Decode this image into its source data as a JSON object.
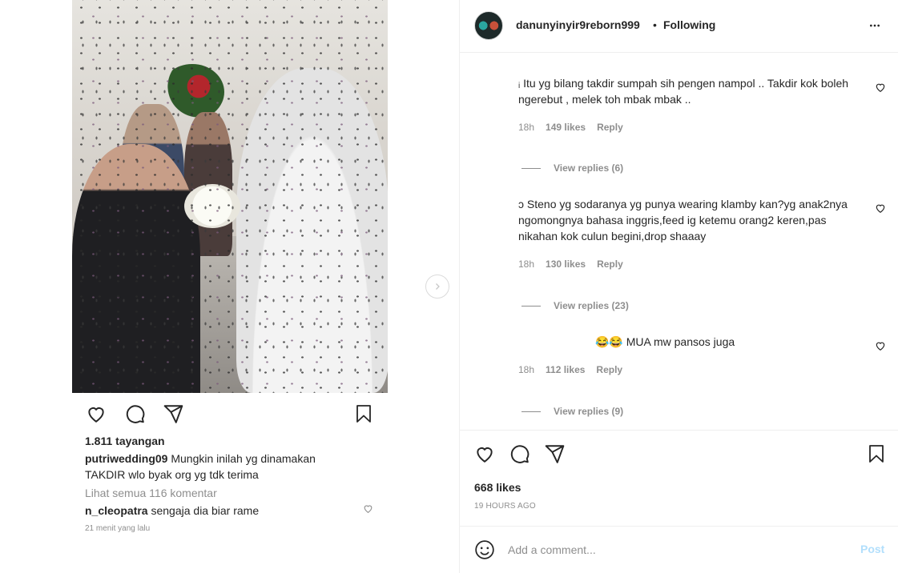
{
  "post": {
    "views": "1.811 tayangan",
    "caption_user": "putriwedding09",
    "caption_text": " Mungkin inilah yg dinamakan TAKDIR wlo byak org yg tdk terima",
    "see_all": "Lihat semua 116 komentar",
    "inner_comment_user": "n_cleopatra",
    "inner_comment_text": " sengaja dia biar rame",
    "inner_time": "21 menit yang lalu"
  },
  "header": {
    "username": "danunyinyir9reborn999",
    "separator": "•",
    "follow_status": "Following"
  },
  "comments": [
    {
      "text": "ᵢ Itu yg bilang takdir sumpah sih pengen nampol .. Takdir kok boleh ngerebut , melek toh mbak mbak ..",
      "time": "18h",
      "likes": "149 likes",
      "reply": "Reply",
      "view_replies": "View replies (6)"
    },
    {
      "text": "ↄ Steno yg sodaranya yg punya wearing klamby kan?yg anak2nya ngomongnya bahasa inggris,feed ig ketemu orang2 keren,pas nikahan kok culun begini,drop shaaay",
      "time": "18h",
      "likes": "130 likes",
      "reply": "Reply",
      "view_replies": "View replies (23)"
    },
    {
      "text": "😂😂 MUA mw pansos juga",
      "time": "18h",
      "likes": "112 likes",
      "reply": "Reply",
      "view_replies": "View replies (9)"
    }
  ],
  "footer": {
    "likes": "668 likes",
    "time_ago": "19 HOURS AGO",
    "comment_placeholder": "Add a comment...",
    "post_label": "Post"
  },
  "colors": {
    "text": "#262626",
    "muted": "#8e8e8e",
    "border": "#efefef",
    "post_disabled": "#b2dffc"
  },
  "icons": [
    "heart-icon",
    "comment-icon",
    "share-icon",
    "bookmark-icon",
    "more-icon",
    "chevron-right-icon",
    "speaker-icon",
    "emoji-icon"
  ]
}
